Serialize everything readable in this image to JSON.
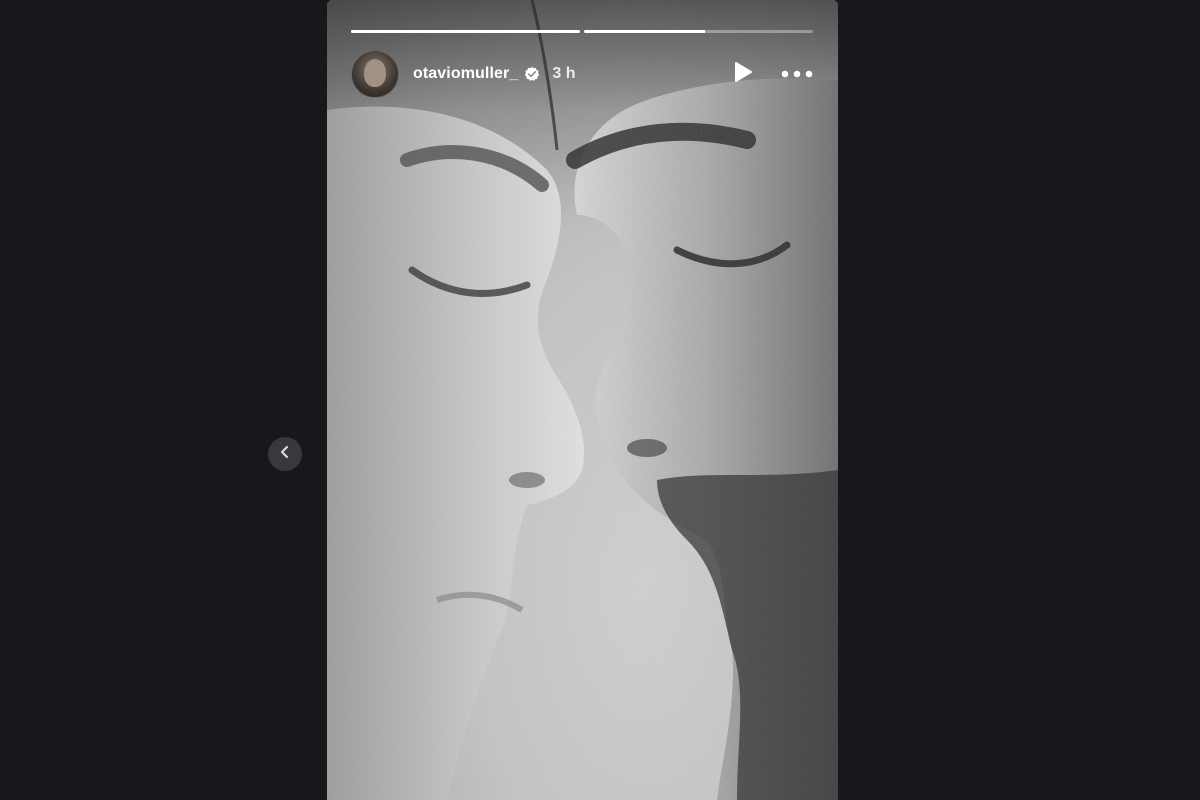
{
  "story": {
    "author": {
      "username": "otaviomuller_",
      "verified": true,
      "avatar_icon": "avatar-photo"
    },
    "posted_ago": "3 h",
    "progress": {
      "segments": [
        {
          "fill": 1.0
        },
        {
          "fill": 0.53
        },
        {
          "fill": 0.0
        }
      ]
    },
    "controls": {
      "play_icon": "play-icon",
      "more_icon": "more-options-icon"
    }
  },
  "navigation": {
    "prev_icon": "chevron-left-icon"
  },
  "colors": {
    "page_background": "#19171b",
    "verified_badge": "#ffffff",
    "nav_button": "#3a383c"
  }
}
